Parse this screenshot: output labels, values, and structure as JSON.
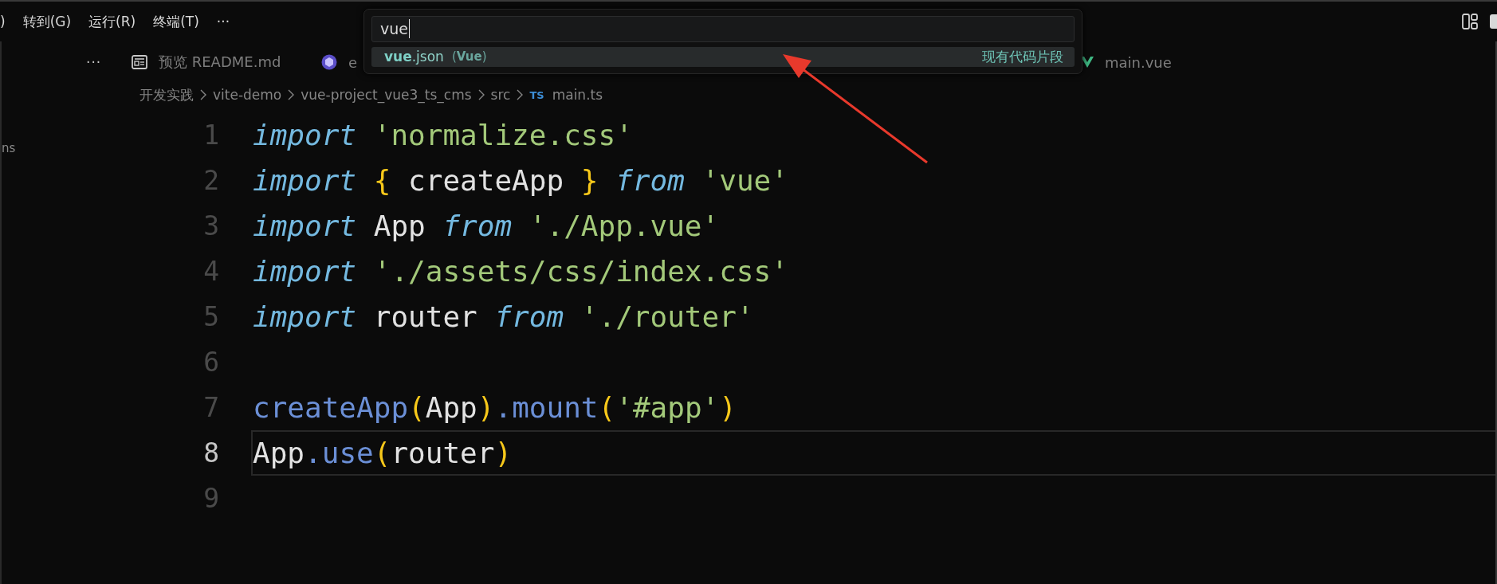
{
  "menu_bar": {
    "items": [
      ")",
      "转到(G)",
      "运行(R)",
      "终端(T)",
      "···"
    ]
  },
  "tabs": {
    "overflow": "···",
    "items": [
      {
        "label": "预览 README.md",
        "kind": "preview",
        "selected": false
      },
      {
        "label": "e",
        "kind": "config",
        "selected": false
      },
      {
        "label": "main.vue",
        "kind": "vue",
        "selected": false
      }
    ]
  },
  "breadcrumb": {
    "items": [
      "开发实践",
      "vite-demo",
      "vue-project_vue3_ts_cms",
      "src"
    ],
    "file_badge": "TS",
    "file": "main.ts"
  },
  "sidebar": {
    "text": "ns"
  },
  "editor": {
    "lines": [
      {
        "number": "1",
        "current": false,
        "tokens": [
          {
            "text": "import ",
            "kind": "keyword"
          },
          {
            "text": "'normalize.css'",
            "kind": "string"
          }
        ]
      },
      {
        "number": "2",
        "current": false,
        "tokens": [
          {
            "text": "import ",
            "kind": "keyword"
          },
          {
            "text": "{",
            "kind": "brace"
          },
          {
            "text": " createApp ",
            "kind": "plain"
          },
          {
            "text": "} ",
            "kind": "brace"
          },
          {
            "text": "from ",
            "kind": "keyword"
          },
          {
            "text": "'vue'",
            "kind": "string"
          }
        ]
      },
      {
        "number": "3",
        "current": false,
        "tokens": [
          {
            "text": "import",
            "kind": "keyword"
          },
          {
            "text": " App ",
            "kind": "plain"
          },
          {
            "text": "from ",
            "kind": "keyword"
          },
          {
            "text": "'./App.vue'",
            "kind": "string"
          }
        ]
      },
      {
        "number": "4",
        "current": false,
        "tokens": [
          {
            "text": "import ",
            "kind": "keyword"
          },
          {
            "text": "'./assets/css/index.css'",
            "kind": "string"
          }
        ]
      },
      {
        "number": "5",
        "current": false,
        "tokens": [
          {
            "text": "import",
            "kind": "keyword"
          },
          {
            "text": " router ",
            "kind": "plain"
          },
          {
            "text": "from ",
            "kind": "keyword"
          },
          {
            "text": "'./router'",
            "kind": "string"
          }
        ]
      },
      {
        "number": "6",
        "current": false
      },
      {
        "number": "7",
        "current": false,
        "tokens": [
          {
            "text": "createApp",
            "kind": "function"
          },
          {
            "text": "(",
            "kind": "brace"
          },
          {
            "text": "App",
            "kind": "plain"
          },
          {
            "text": ")",
            "kind": "brace"
          },
          {
            "text": ".mount",
            "kind": "function"
          },
          {
            "text": "(",
            "kind": "brace"
          },
          {
            "text": "'#app'",
            "kind": "string"
          },
          {
            "text": ")",
            "kind": "brace"
          }
        ]
      },
      {
        "number": "8",
        "current": true,
        "tokens": [
          {
            "text": "App",
            "kind": "plain"
          },
          {
            "text": ".use",
            "kind": "function"
          },
          {
            "text": "(",
            "kind": "brace"
          },
          {
            "text": "router",
            "kind": "plain"
          },
          {
            "text": ")",
            "kind": "brace"
          }
        ]
      },
      {
        "number": "9",
        "current": false
      }
    ]
  },
  "quick_pick": {
    "value": "vue",
    "results": [
      {
        "label": "**vue**.json",
        "detail": "(**Vue**)",
        "description": "现有代码片段",
        "selected": true
      }
    ]
  }
}
